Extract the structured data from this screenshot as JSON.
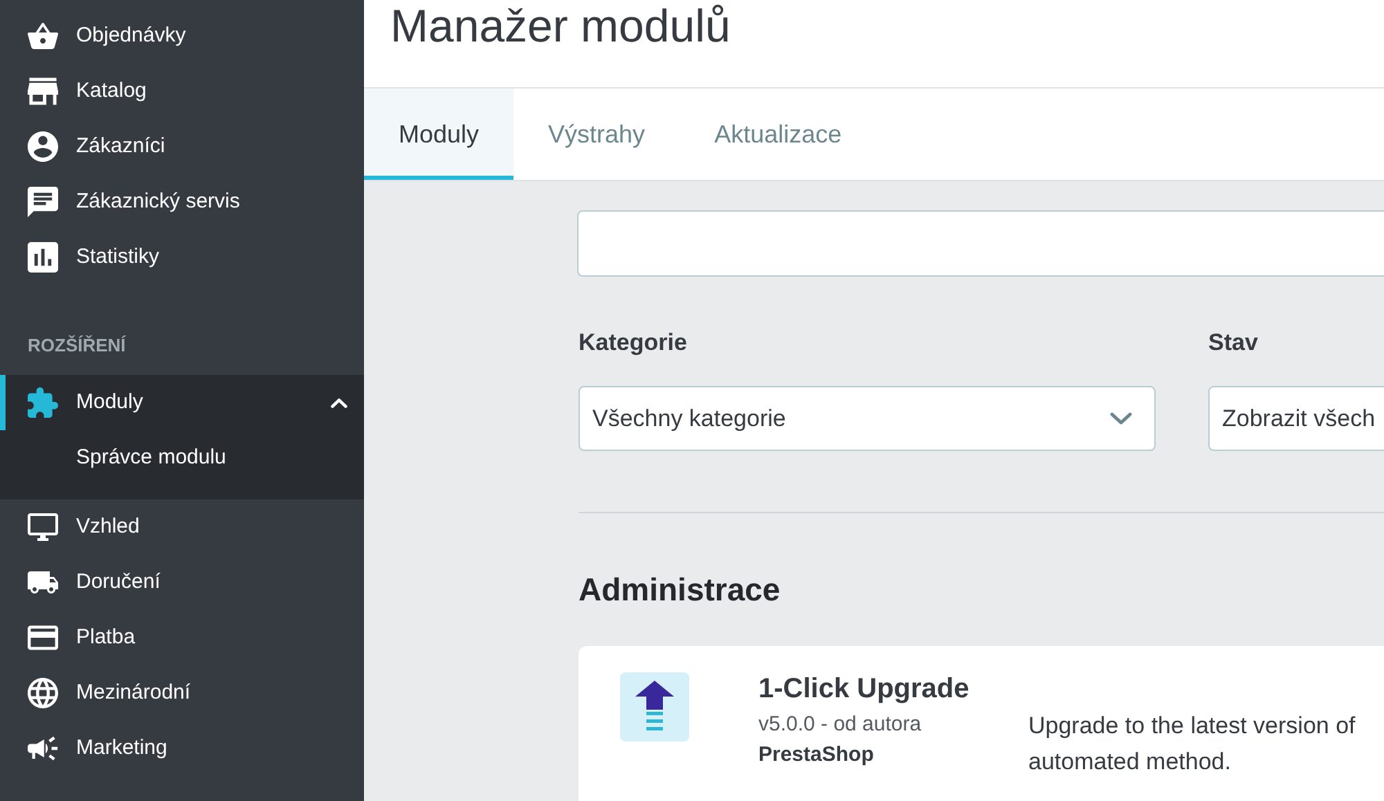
{
  "sidebar": {
    "items": [
      {
        "kind": "link",
        "label": "Objednávky",
        "selected": false,
        "expanded": false
      },
      {
        "kind": "link",
        "label": "Katalog",
        "selected": false,
        "expanded": false
      },
      {
        "kind": "link",
        "label": "Zákazníci",
        "selected": false,
        "expanded": false
      },
      {
        "kind": "link",
        "label": "Zákaznický servis",
        "selected": false,
        "expanded": false
      },
      {
        "kind": "link",
        "label": "Statistiky",
        "selected": false,
        "expanded": false
      },
      {
        "kind": "section",
        "label": "ROZŠÍŘENÍ"
      },
      {
        "kind": "link",
        "label": "Moduly",
        "selected": true,
        "expanded": true,
        "children": [
          {
            "label": "Správce modulu"
          }
        ]
      },
      {
        "kind": "link",
        "label": "Vzhled",
        "selected": false,
        "expanded": false
      },
      {
        "kind": "link",
        "label": "Doručení",
        "selected": false,
        "expanded": false
      },
      {
        "kind": "link",
        "label": "Platba",
        "selected": false,
        "expanded": false
      },
      {
        "kind": "link",
        "label": "Mezinárodní",
        "selected": false,
        "expanded": false
      },
      {
        "kind": "link",
        "label": "Marketing",
        "selected": false,
        "expanded": false
      }
    ]
  },
  "page": {
    "title": "Manažer modulů"
  },
  "tabs": [
    {
      "label": "Moduly",
      "selected": true
    },
    {
      "label": "Výstrahy",
      "selected": false
    },
    {
      "label": "Aktualizace",
      "selected": false
    }
  ],
  "filters": [
    {
      "label": "Kategorie",
      "value": "Všechny kategorie"
    },
    {
      "label": "Stav",
      "value": "Zobrazit všech"
    }
  ],
  "sections": [
    {
      "title": "Administrace",
      "modules": [
        {
          "name": "1-Click Upgrade",
          "version": "v5.0.0 - od autora",
          "author": "PrestaShop",
          "description": [
            "Upgrade to the latest version of",
            "automated method."
          ]
        }
      ]
    }
  ]
}
